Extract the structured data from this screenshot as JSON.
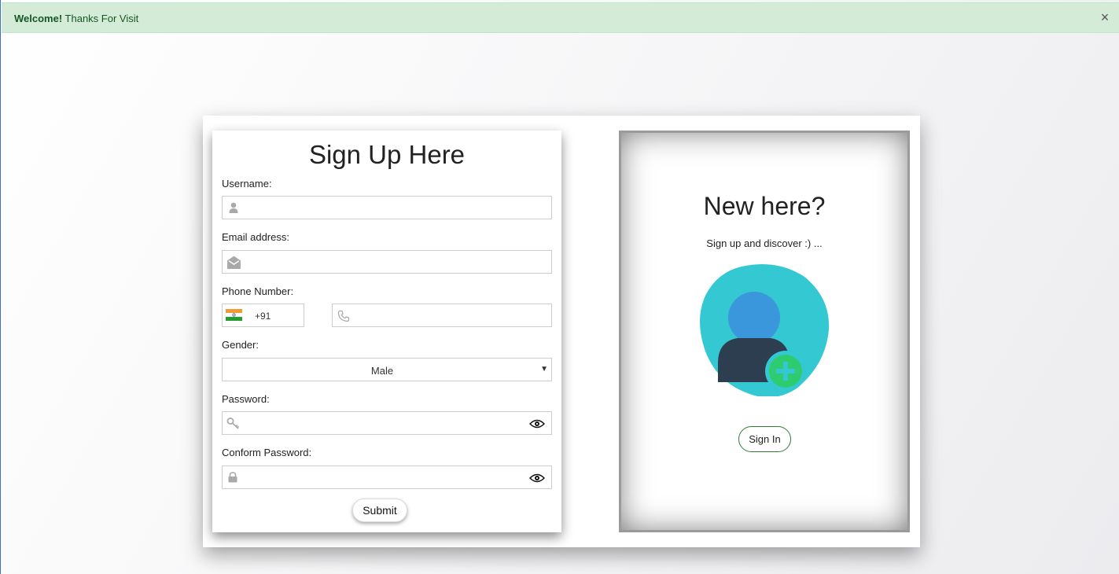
{
  "alert": {
    "strong": "Welcome!",
    "text": " Thanks For Visit",
    "close": "×"
  },
  "form": {
    "title": "Sign Up Here",
    "username_label": "Username:",
    "email_label": "Email address:",
    "phone_label": "Phone Number:",
    "country_code": "+91",
    "gender_label": "Gender:",
    "gender_selected": "Male",
    "password_label": "Password:",
    "confirm_label": "Conform Password:",
    "submit": "Submit"
  },
  "side": {
    "title": "New here?",
    "subtitle": "Sign up and discover :) ...",
    "signin": "Sign In"
  },
  "colors": {
    "alert_bg": "#d4ebd8",
    "alert_text": "#155724",
    "blob": "#33c8d2",
    "avatar_head": "#3a97db",
    "avatar_body": "#2c3e50",
    "plus_badge": "#2ecc71",
    "signin_border": "#2e7d32"
  }
}
